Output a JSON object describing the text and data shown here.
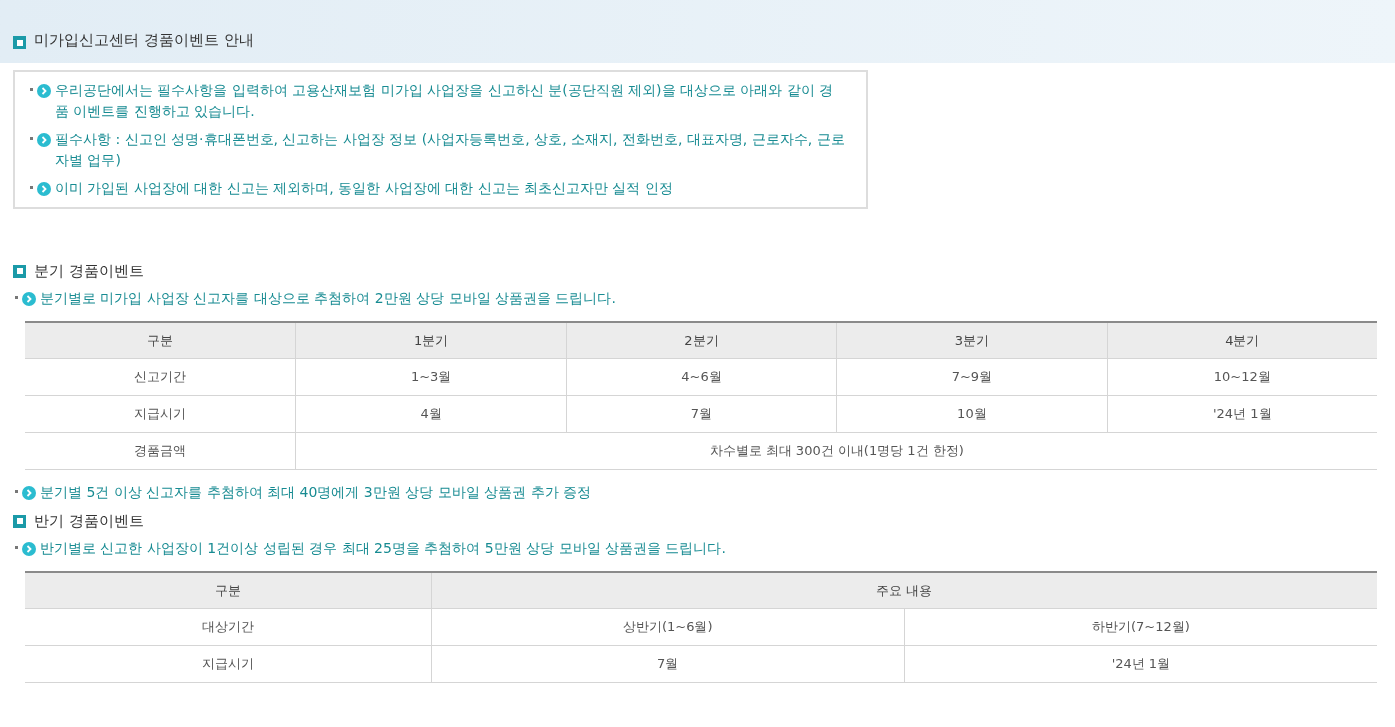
{
  "page_title": "미가입신고센터 경품이벤트 안내",
  "notice": [
    "우리공단에서는 필수사항을 입력하여 고용산재보험 미가입 사업장을 신고하신 분(공단직원 제외)을 대상으로 아래와 같이 경품 이벤트를 진행하고 있습니다.",
    "필수사항 : 신고인 성명·휴대폰번호, 신고하는 사업장 정보 (사업자등록번호, 상호, 소재지, 전화번호, 대표자명, 근로자수, 근로자별 업무)",
    "이미 가입된 사업장에 대한 신고는 제외하며, 동일한 사업장에 대한 신고는 최초신고자만 실적 인정"
  ],
  "sections": [
    {
      "title": "분기 경품이벤트",
      "intro": "분기별로 미가입 사업장 신고자를 대상으로 추첨하여 2만원 상당 모바일 상품권을 드립니다.",
      "table": {
        "columns": [
          "구분",
          "1분기",
          "2분기",
          "3분기",
          "4분기"
        ],
        "rows": [
          [
            "신고기간",
            "1~3월",
            "4~6월",
            "7~9월",
            "10~12월"
          ],
          [
            "지급시기",
            "4월",
            "7월",
            "10월",
            "'24년 1월"
          ],
          [
            "경품금액",
            "차수별로 최대 300건 이내(1명당 1건 한정)"
          ]
        ]
      },
      "note": "분기별 5건 이상 신고자를 추첨하여 최대 40명에게 3만원 상당 모바일 상품권 추가 증정"
    },
    {
      "title": "반기 경품이벤트",
      "intro": "반기별로 신고한 사업장이 1건이상 성립된 경우 최대 25명을 추첨하여 5만원 상당 모바일 상품권을 드립니다.",
      "table": {
        "columns": [
          "구분",
          "주요 내용"
        ],
        "rows": [
          [
            "대상기간",
            "상반기(1~6월)",
            "하반기(7~12월)"
          ],
          [
            "지급시기",
            "7월",
            "'24년 1월"
          ]
        ]
      }
    }
  ]
}
